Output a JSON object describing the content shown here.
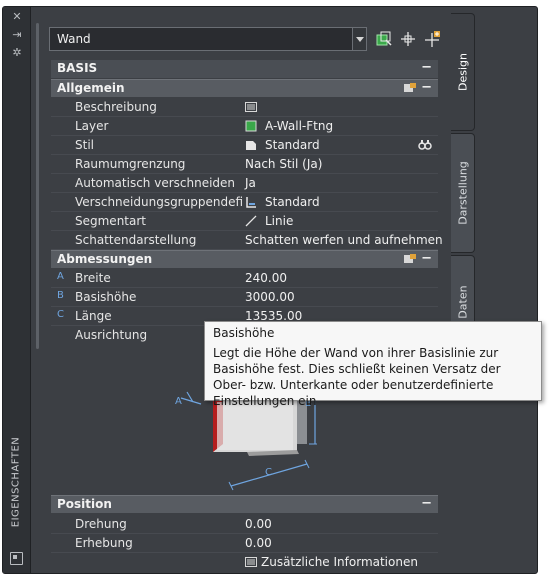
{
  "palette": {
    "title": "EIGENSCHAFTEN",
    "tabs": [
      {
        "label": "Design"
      },
      {
        "label": "Darstellung"
      },
      {
        "label": "erte Daten"
      }
    ]
  },
  "top": {
    "object_type": "Wand"
  },
  "sections": {
    "basis": "BASIS",
    "allgemein": "Allgemein",
    "abmessungen": "Abmessungen",
    "position": "Position"
  },
  "allgemein": [
    {
      "key": "Beschreibung",
      "value": ""
    },
    {
      "key": "Layer",
      "value": "A-Wall-Ftng",
      "color": "#3aa84a"
    },
    {
      "key": "Stil",
      "value": "Standard"
    },
    {
      "key": "Raumumgrenzung",
      "value": "Nach Stil (Ja)"
    },
    {
      "key": "Automatisch verschneiden",
      "value": "Ja"
    },
    {
      "key": "Verschneidungsgruppendefi...",
      "value": "Standard"
    },
    {
      "key": "Segmentart",
      "value": "Linie"
    },
    {
      "key": "Schattendarstellung",
      "value": "Schatten werfen und aufnehmen"
    }
  ],
  "abmessungen": [
    {
      "letter": "A",
      "key": "Breite",
      "value": "240.00"
    },
    {
      "letter": "B",
      "key": "Basishöhe",
      "value": "3000.00"
    },
    {
      "letter": "C",
      "key": "Länge",
      "value": "13535.00"
    },
    {
      "letter": "",
      "key": "Ausrichtung",
      "value": ""
    }
  ],
  "diagram_labels": {
    "a": "A",
    "b": "B",
    "c": "C"
  },
  "position": [
    {
      "key": "Drehung",
      "value": "0.00"
    },
    {
      "key": "Erhebung",
      "value": "0.00"
    },
    {
      "key": "",
      "value": "Zusätzliche Informationen"
    }
  ],
  "tooltip": {
    "title": "Basishöhe",
    "body": "Legt die Höhe der Wand von ihrer Basislinie zur Basishöhe fest. Dies schließt keinen Versatz der Ober- bzw. Unterkante oder benutzerdefinierte Einstellungen ein"
  },
  "colors": {
    "palette_bg": "#3c3f44",
    "category_bg": "#585c62",
    "accent_blue": "#6fa5e0"
  }
}
